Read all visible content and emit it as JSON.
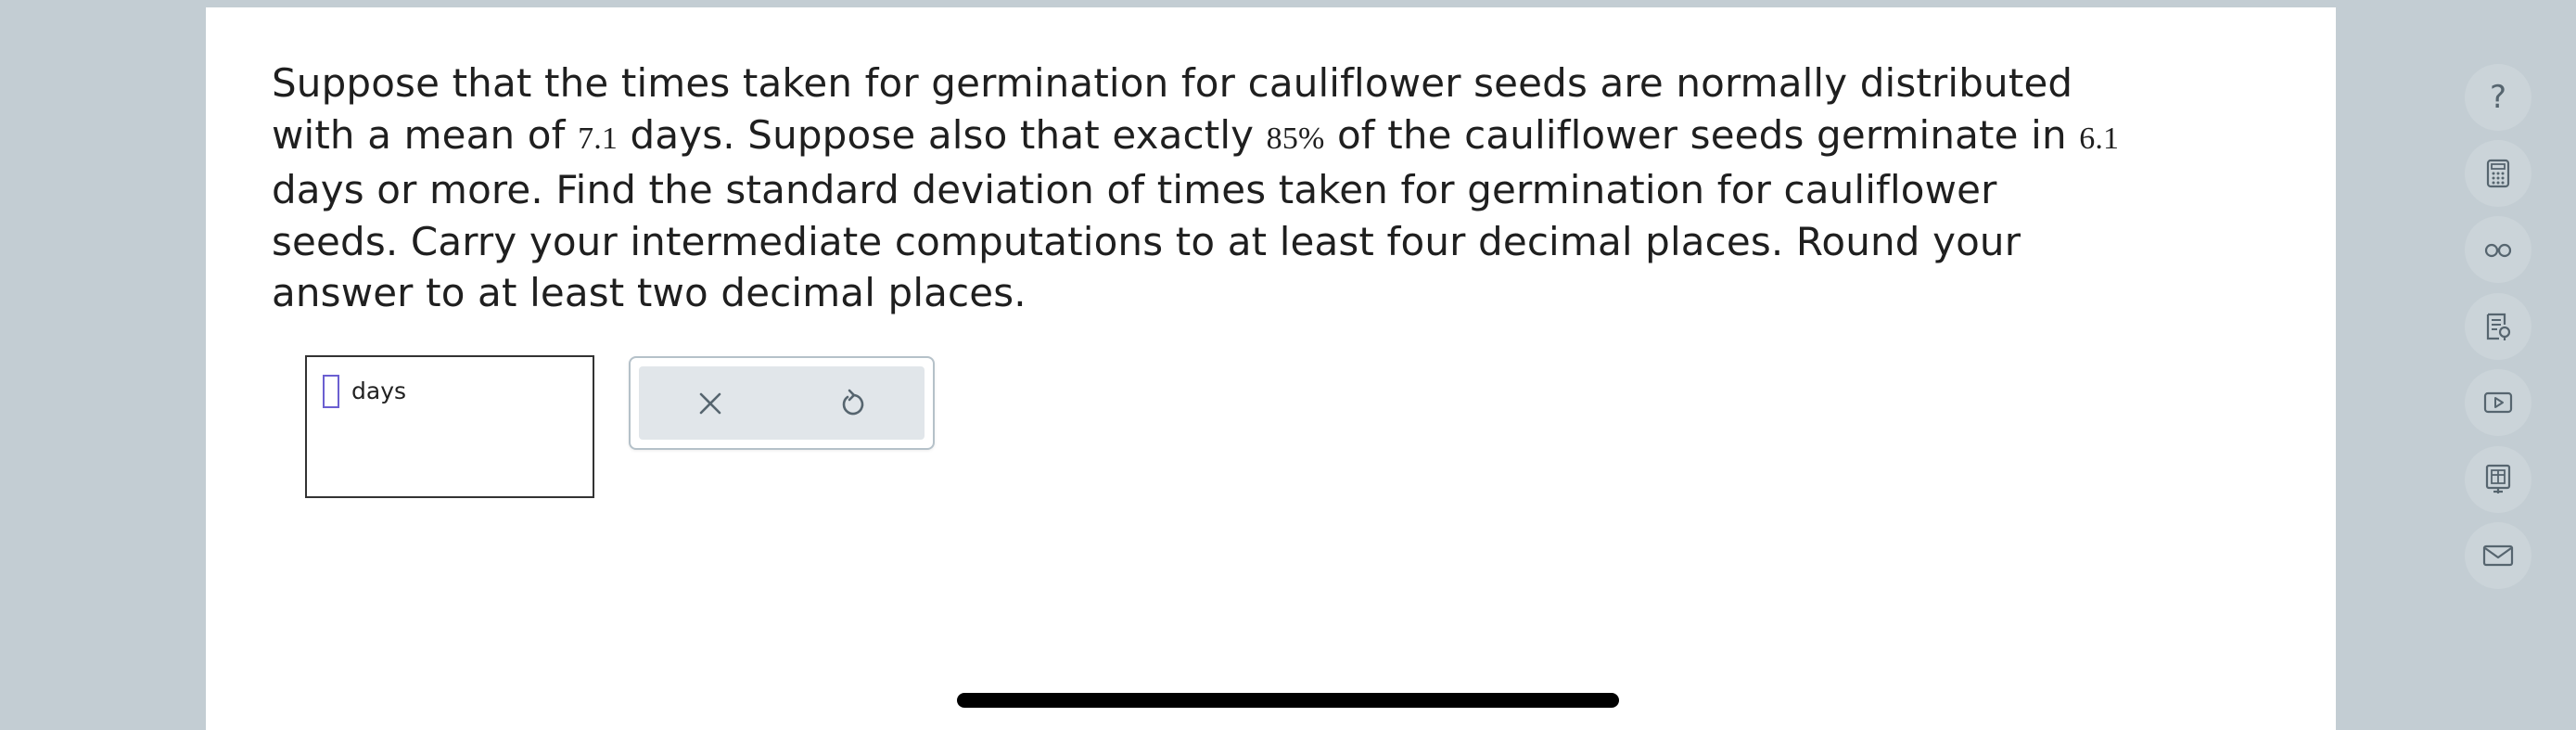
{
  "question": {
    "p1": "Suppose that the times taken for germination for cauliflower seeds are normally distributed",
    "p2": "with a mean of ",
    "mean": "7.1",
    "p3": " days. Suppose also that exactly ",
    "percent": "85%",
    "p4": " of the cauliflower seeds germinate in ",
    "threshold": "6.1",
    "p5": "days or more. Find the standard deviation of times taken for germination for cauliflower",
    "p6": "seeds. Carry your intermediate computations to at least four decimal places. Round your",
    "p7": "answer to at least two decimal places."
  },
  "answer": {
    "value": "",
    "unit": "days"
  },
  "tools": {
    "clear_icon": "close-icon",
    "undo_icon": "undo-icon"
  },
  "side_toolbar": {
    "items": [
      {
        "icon": "question-icon",
        "glyph": "?"
      },
      {
        "icon": "calculator-icon"
      },
      {
        "icon": "glasses-icon"
      },
      {
        "icon": "textbook-icon"
      },
      {
        "icon": "video-icon"
      },
      {
        "icon": "data-table-icon"
      },
      {
        "icon": "mail-icon"
      }
    ]
  },
  "colors": {
    "background": "#c3cdd3",
    "panel": "#ffffff",
    "text": "#1f1f1f",
    "input_border": "#6b5fd1",
    "tool_bg": "#e1e6ea",
    "icon": "#56656f"
  }
}
